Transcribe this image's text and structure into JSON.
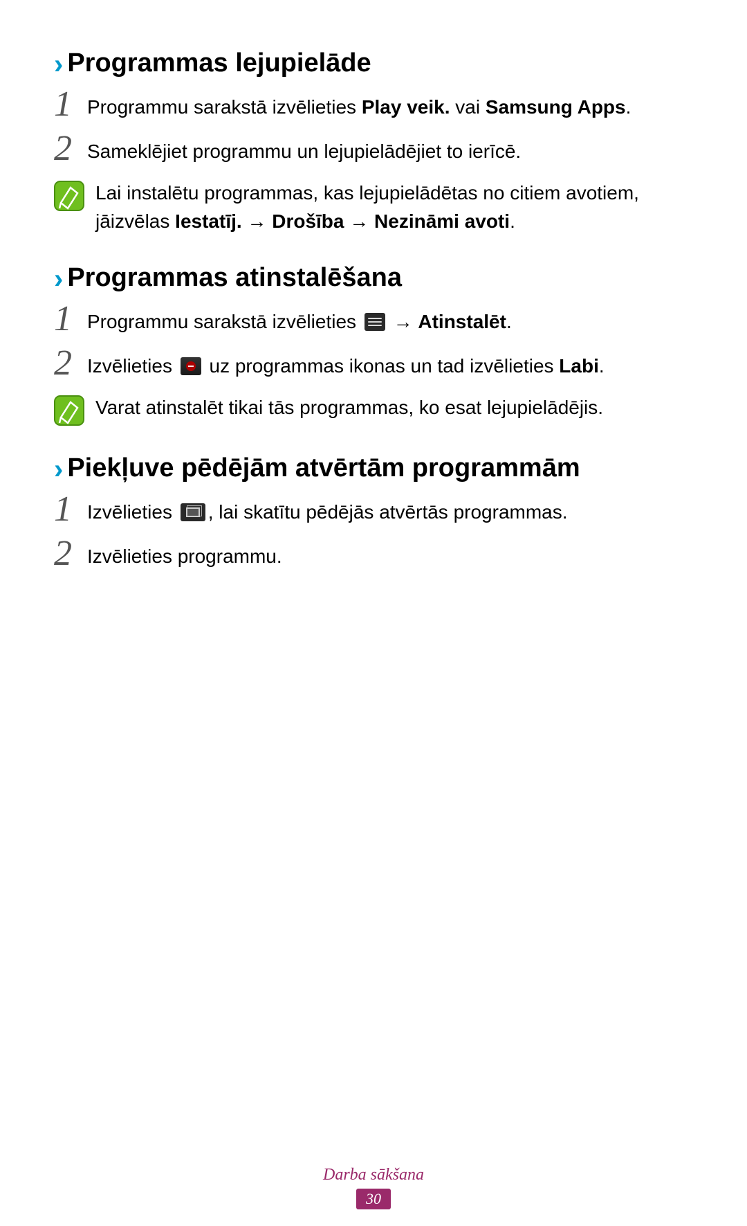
{
  "sections": [
    {
      "heading": "Programmas lejupielāde",
      "steps": [
        {
          "num": "1",
          "prefix": "Programmu sarakstā izvēlieties ",
          "bold1": "Play veik.",
          "mid1": " vai ",
          "bold2": "Samsung Apps",
          "suffix": "."
        },
        {
          "num": "2",
          "text": "Sameklējiet programmu un lejupielādējiet to ierīcē."
        }
      ],
      "note": {
        "prefix": "Lai instalētu programmas, kas lejupielādētas no citiem avotiem, jāizvēlas ",
        "bold1": "Iestatīj.",
        "arrow1": " → ",
        "bold2": "Drošība",
        "arrow2": " → ",
        "bold3": "Nezināmi avoti",
        "suffix": "."
      }
    },
    {
      "heading": "Programmas atinstalēšana",
      "steps": [
        {
          "num": "1",
          "prefix": "Programmu sarakstā izvēlieties ",
          "arrow": " → ",
          "bold": "Atinstalēt",
          "suffix": "."
        },
        {
          "num": "2",
          "prefix": "Izvēlieties ",
          "mid": " uz programmas ikonas un tad izvēlieties ",
          "bold": "Labi",
          "suffix": "."
        }
      ],
      "note": {
        "text": "Varat atinstalēt tikai tās programmas, ko esat lejupielādējis."
      }
    },
    {
      "heading": "Piekļuve pēdējām atvērtām programmām",
      "steps": [
        {
          "num": "1",
          "prefix": "Izvēlieties ",
          "suffix": ", lai skatītu pēdējās atvērtās programmas."
        },
        {
          "num": "2",
          "text": "Izvēlieties programmu."
        }
      ]
    }
  ],
  "footer": {
    "label": "Darba sākšana",
    "page": "30"
  }
}
